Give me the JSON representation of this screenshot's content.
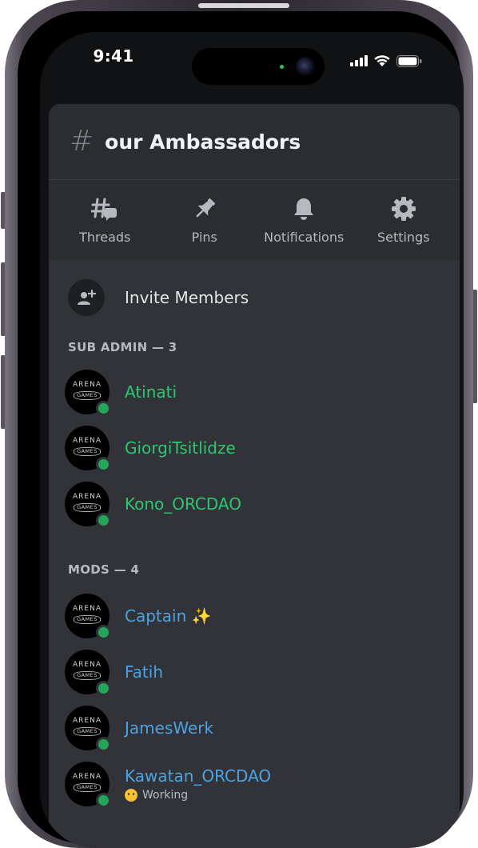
{
  "status_bar": {
    "time": "9:41"
  },
  "channel": {
    "hash_icon": "hash-icon",
    "name": "our Ambassadors"
  },
  "actions": [
    {
      "icon": "threads-icon",
      "label": "Threads"
    },
    {
      "icon": "pin-icon",
      "label": "Pins"
    },
    {
      "icon": "bell-icon",
      "label": "Notifications"
    },
    {
      "icon": "gear-icon",
      "label": "Settings"
    }
  ],
  "invite": {
    "icon": "add-user-icon",
    "label": "Invite Members"
  },
  "avatar_logo": {
    "line1": "ARENA",
    "line2": "GAMES"
  },
  "sections": [
    {
      "title": "SUB ADMIN — 3",
      "color": "#2dc770",
      "members": [
        {
          "name": "Atinati"
        },
        {
          "name": "GiorgiTsitlidze"
        },
        {
          "name": "Kono_ORCDAO"
        }
      ]
    },
    {
      "title": "MODS — 4",
      "color": "#4ba3e3",
      "members": [
        {
          "name": "Captain ✨"
        },
        {
          "name": "Fatih"
        },
        {
          "name": "JamesWerk"
        },
        {
          "name": "Kawatan_ORCDAO",
          "status": "Working"
        }
      ]
    }
  ]
}
